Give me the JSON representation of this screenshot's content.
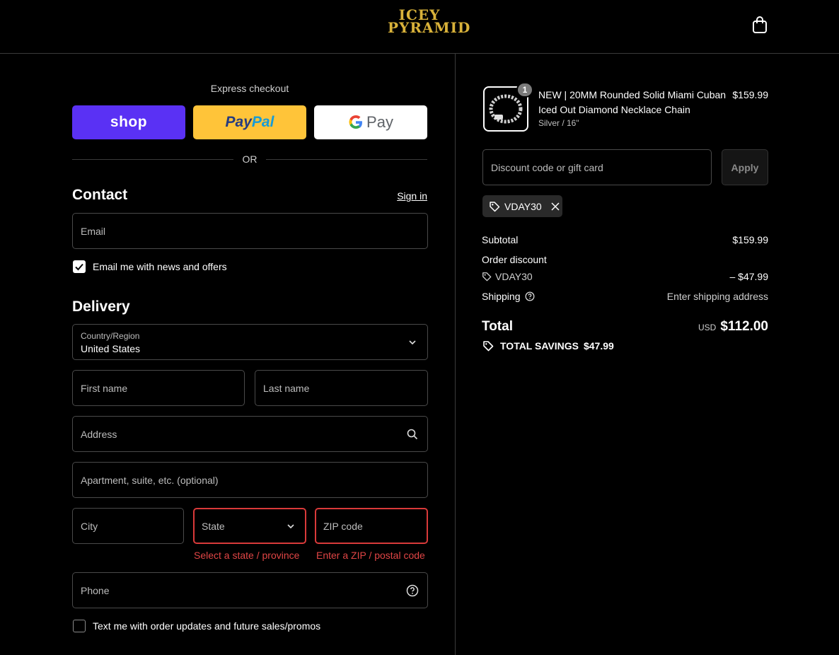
{
  "header": {
    "logo_line1": "ICEY",
    "logo_line2": "PYRAMID"
  },
  "express": {
    "label": "Express checkout",
    "shop_label": "shop",
    "paypal_part1": "Pay",
    "paypal_part2": "Pal",
    "gpay_label": "Pay",
    "or_label": "OR"
  },
  "contact": {
    "title": "Contact",
    "sign_in": "Sign in",
    "email_placeholder": "Email",
    "news_label": "Email me with news and offers",
    "news_checked": true
  },
  "delivery": {
    "title": "Delivery",
    "country_label": "Country/Region",
    "country_value": "United States",
    "first_name": "First name",
    "last_name": "Last name",
    "address": "Address",
    "apartment": "Apartment, suite, etc. (optional)",
    "city": "City",
    "state": "State",
    "zip": "ZIP code",
    "state_error": "Select a state / province",
    "zip_error": "Enter a ZIP / postal code",
    "phone": "Phone",
    "sms_label": "Text me with order updates and future sales/promos",
    "sms_checked": false
  },
  "summary": {
    "product": {
      "qty": "1",
      "name": "NEW | 20MM Rounded Solid Miami Cuban Iced Out Diamond Necklace Chain",
      "variant": "Silver / 16\"",
      "price": "$159.99"
    },
    "discount_placeholder": "Discount code or gift card",
    "apply_label": "Apply",
    "applied_code": "VDAY30",
    "subtotal_label": "Subtotal",
    "subtotal_value": "$159.99",
    "order_discount_label": "Order discount",
    "discount_code": "VDAY30",
    "discount_value": "– $47.99",
    "shipping_label": "Shipping",
    "shipping_value": "Enter shipping address",
    "total_label": "Total",
    "total_currency": "USD",
    "total_value": "$112.00",
    "savings_label": "TOTAL SAVINGS",
    "savings_value": "$47.99"
  },
  "colors": {
    "background": "#000000",
    "shop_purple": "#5a31f4",
    "paypal_yellow": "#ffc439",
    "error_red": "#d93a3a",
    "logo_gold": "#d9b23a"
  }
}
